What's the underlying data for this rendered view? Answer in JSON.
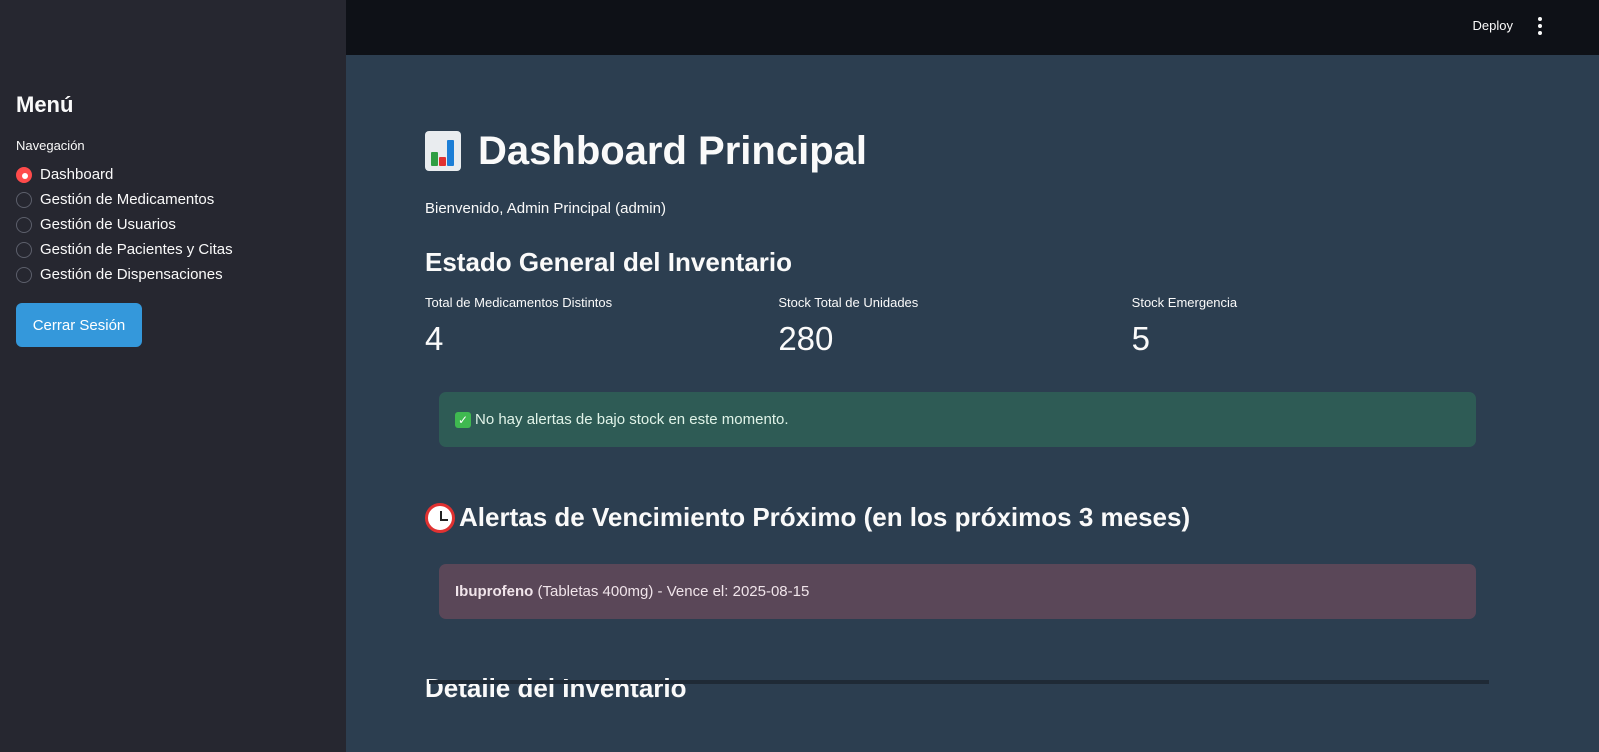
{
  "sidebar": {
    "title": "Menú",
    "nav_label": "Navegación",
    "items": [
      {
        "label": "Dashboard",
        "selected": true
      },
      {
        "label": "Gestión de Medicamentos",
        "selected": false
      },
      {
        "label": "Gestión de Usuarios",
        "selected": false
      },
      {
        "label": "Gestión de Pacientes y Citas",
        "selected": false
      },
      {
        "label": "Gestión de Dispensaciones",
        "selected": false
      }
    ],
    "logout_label": "Cerrar Sesión"
  },
  "topbar": {
    "deploy_label": "Deploy",
    "menu_icon": "kebab-menu-icon"
  },
  "main": {
    "title": "Dashboard Principal",
    "title_icon": "bar-chart-icon",
    "welcome": "Bienvenido, Admin Principal (admin)",
    "inventory_section": "Estado General del Inventario",
    "metrics": [
      {
        "label": "Total de Medicamentos Distintos",
        "value": "4"
      },
      {
        "label": "Stock Total de Unidades",
        "value": "280"
      },
      {
        "label": "Stock Emergencia",
        "value": "5"
      }
    ],
    "stock_alert": "No hay alertas de bajo stock en este momento.",
    "expiry_section": "Alertas de Vencimiento Próximo (en los próximos 3 meses)",
    "expiry_alert": {
      "name": "Ibuprofeno",
      "detail": " (Tabletas 400mg) - Vence el: 2025-08-15"
    },
    "detail_section": "Detalle del Inventario"
  },
  "colors": {
    "accent": "#ff4b4b",
    "button": "#3498db",
    "background": "#2c3e50",
    "sidebar": "#262730"
  }
}
